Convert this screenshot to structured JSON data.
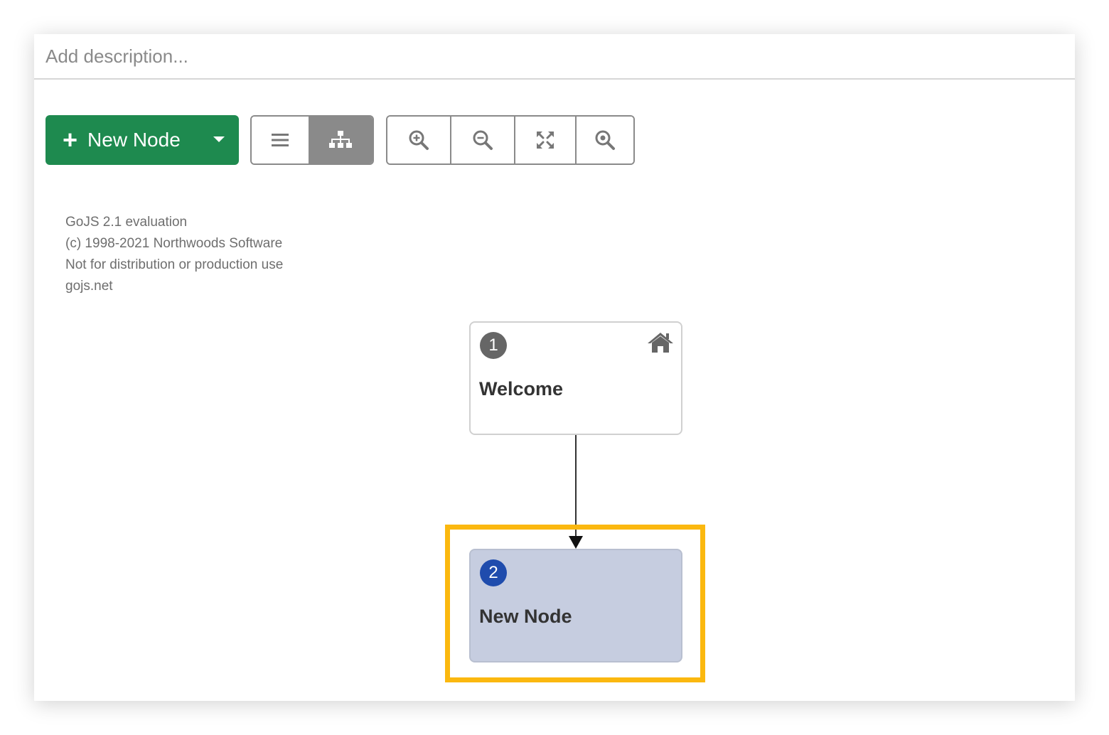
{
  "description": {
    "placeholder": "Add description..."
  },
  "toolbar": {
    "new_node_label": "New Node",
    "new_node_color": "#1e8a4f",
    "view_buttons": [
      {
        "icon": "list-icon",
        "active": false
      },
      {
        "icon": "org-chart-icon",
        "active": true
      }
    ],
    "zoom_buttons": [
      {
        "icon": "zoom-in-icon"
      },
      {
        "icon": "zoom-out-icon"
      },
      {
        "icon": "fit-to-screen-icon"
      },
      {
        "icon": "zoom-reset-icon"
      }
    ]
  },
  "watermark": {
    "line1": "GoJS 2.1 evaluation",
    "line2": "(c) 1998-2021 Northwoods Software",
    "line3": "Not for distribution or production use",
    "line4": "gojs.net"
  },
  "diagram": {
    "nodes": [
      {
        "number": "1",
        "title": "Welcome",
        "icon": "home-icon",
        "badge_color": "#666666"
      },
      {
        "number": "2",
        "title": "New Node",
        "selected": true,
        "badge_color": "#1f4cad",
        "fill": "#c6cde0"
      }
    ],
    "edges": [
      {
        "from": "1",
        "to": "2"
      }
    ],
    "highlight_color": "#fbb80f"
  }
}
